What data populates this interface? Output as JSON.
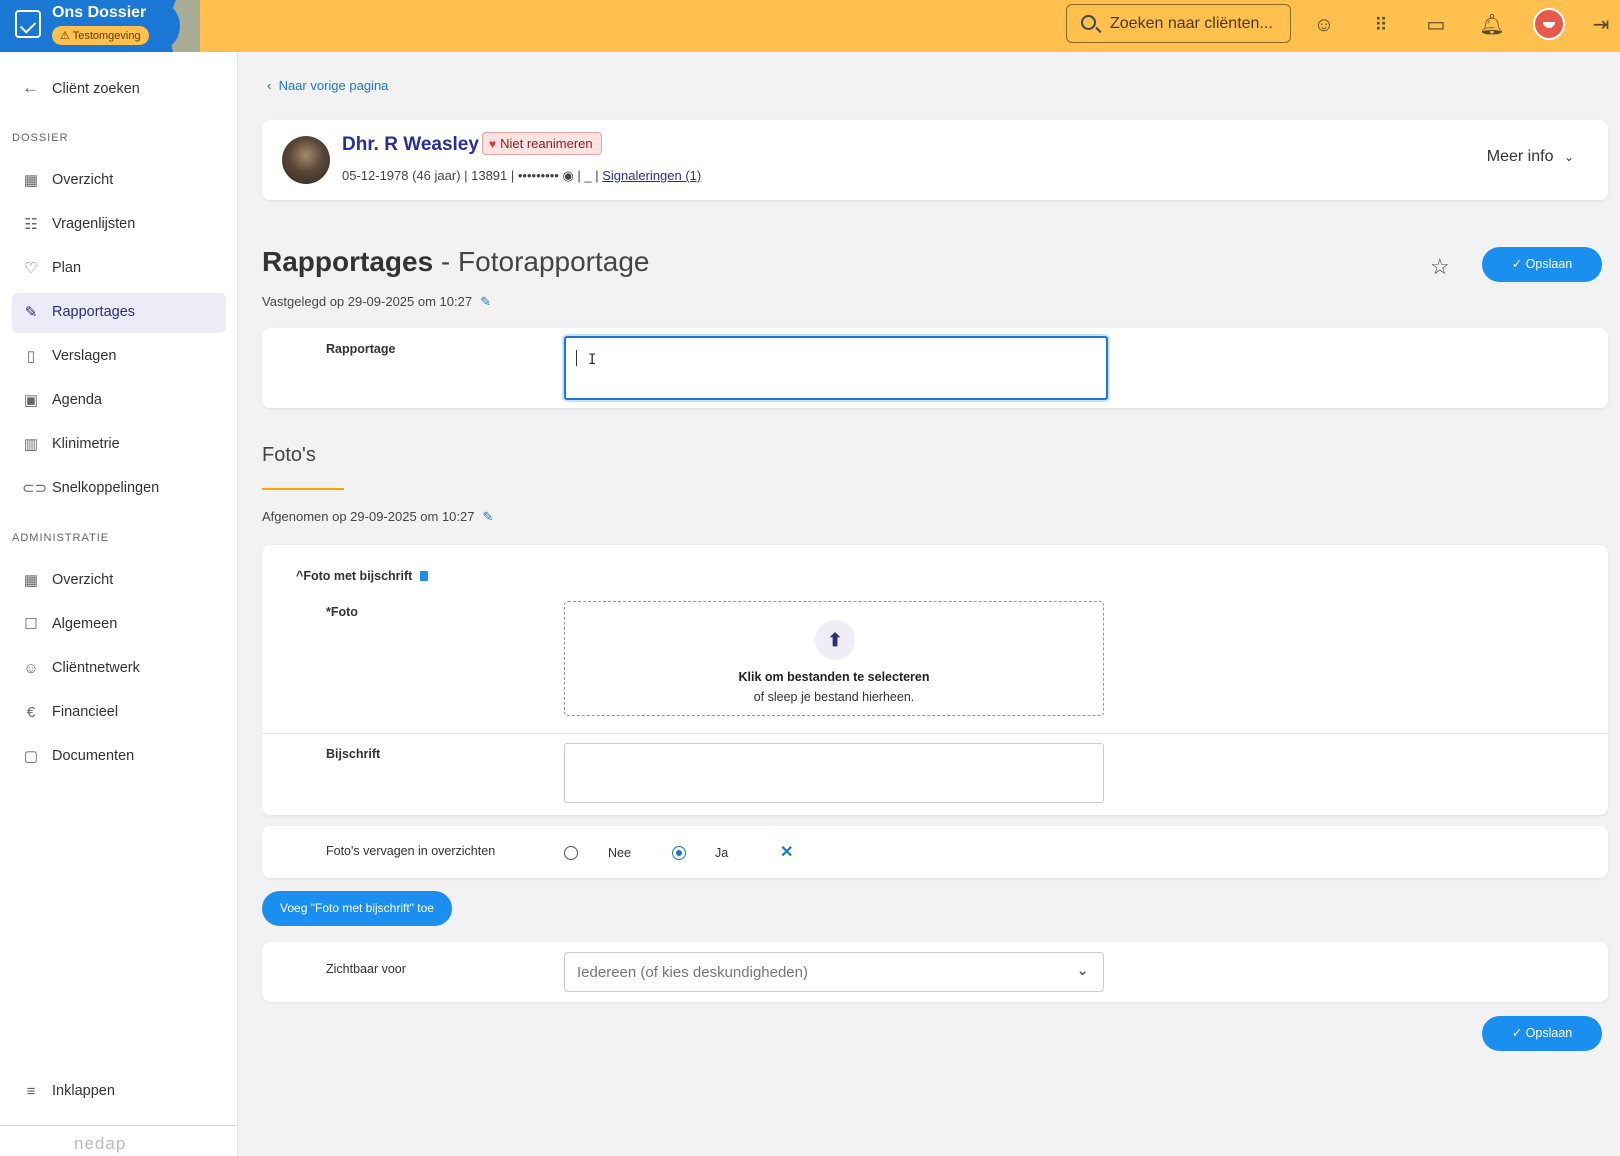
{
  "app": {
    "title": "Ons Dossier",
    "env_badge": "⚠ Testomgeving",
    "search_placeholder": "Zoeken naar cliënten...",
    "colors": {
      "topbar": "#ffc04d",
      "brand": "#1a78d4",
      "primary": "#1a8ff0"
    }
  },
  "topbar_icons": [
    "mood-icon",
    "apps-grid-icon",
    "chat-icon",
    "bell-icon",
    "avatar",
    "logout-icon"
  ],
  "sidebar": {
    "back_label": "Cliënt zoeken",
    "section_dossier": "DOSSIER",
    "dossier_items": [
      {
        "label": "Overzicht",
        "icon": "grid-icon"
      },
      {
        "label": "Vragenlijsten",
        "icon": "questionnaire-icon"
      },
      {
        "label": "Plan",
        "icon": "plan-icon"
      },
      {
        "label": "Rapportages",
        "icon": "report-icon",
        "active": true
      },
      {
        "label": "Verslagen",
        "icon": "document-icon"
      },
      {
        "label": "Agenda",
        "icon": "calendar-icon"
      },
      {
        "label": "Klinimetrie",
        "icon": "chart-icon"
      },
      {
        "label": "Snelkoppelingen",
        "icon": "link-icon"
      }
    ],
    "section_admin": "ADMINISTRATIE",
    "admin_items": [
      {
        "label": "Overzicht",
        "icon": "grid-icon"
      },
      {
        "label": "Algemeen",
        "icon": "profile-icon"
      },
      {
        "label": "Cliëntnetwerk",
        "icon": "network-icon"
      },
      {
        "label": "Financieel",
        "icon": "euro-icon"
      },
      {
        "label": "Documenten",
        "icon": "folder-icon"
      }
    ],
    "collapse_label": "Inklappen",
    "footer_logo": "nedap"
  },
  "main": {
    "back_link": "Naar vorige pagina",
    "client": {
      "name": "Dhr. R Weasley",
      "tag": "Niet reanimeren",
      "meta_prefix": "05-12-1978 (46 jaar) | 13891 | ••••••••• ",
      "meta_sep": " | _ | ",
      "meta_link": "Signaleringen (1)",
      "more_info": "Meer info"
    },
    "title_bold": "Rapportages",
    "title_rest": " - Fotorapportage",
    "recorded": "Vastgelegd op 29-09-2025 om 10:27",
    "save_label": "✓ Opslaan",
    "rapportage_label": "Rapportage",
    "photos_title": "Foto's",
    "taken": "Afgenomen op 29-09-2025 om 10:27",
    "photo_group": {
      "title": "Foto met bijschrift",
      "foto_label": "*Foto",
      "drop_main": "Klik om bestanden te selecteren",
      "drop_sub": "of sleep je bestand hierheen.",
      "caption_label": "Bijschrift"
    },
    "replace_label": "Foto's vervagen in overzichten",
    "radio_no": "Nee",
    "radio_yes": "Ja",
    "radio_selected": "Ja",
    "add_button": "Voeg \"Foto met bijschrift\" toe",
    "visible_label": "Zichtbaar voor",
    "visible_value": "Iedereen (of kies deskundigheden)"
  }
}
